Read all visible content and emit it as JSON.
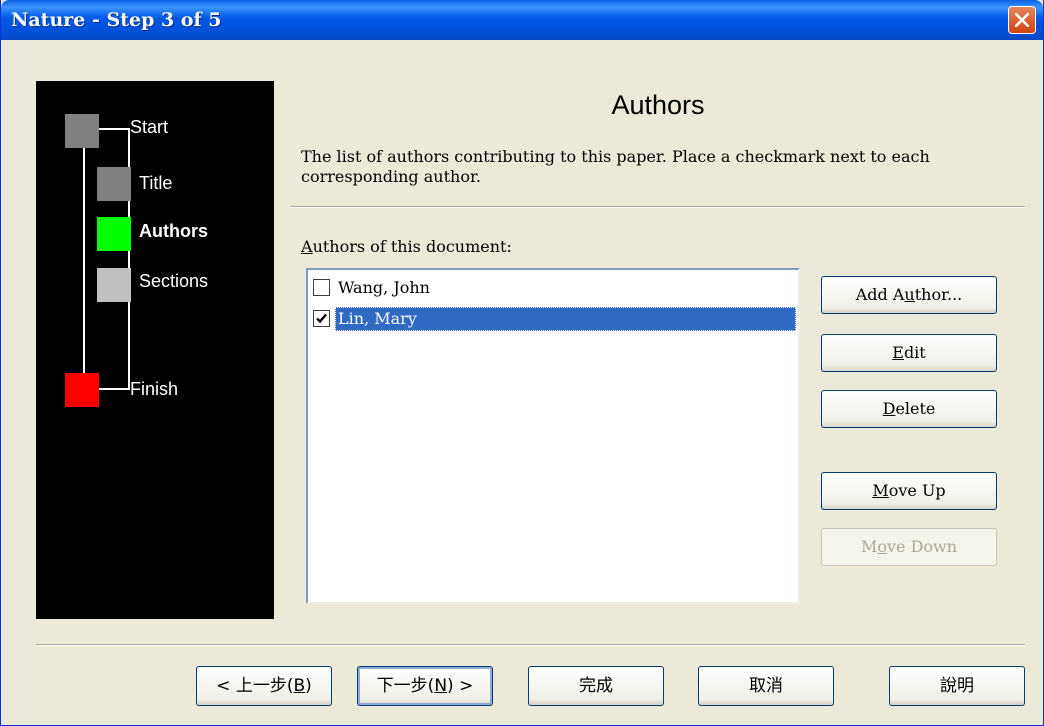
{
  "window": {
    "title": "Nature - Step 3 of 5"
  },
  "steps": [
    {
      "label": "Start",
      "color": "#808080",
      "current": false
    },
    {
      "label": "Title",
      "color": "#808080",
      "current": false
    },
    {
      "label": "Authors",
      "color": "#00FF00",
      "current": true
    },
    {
      "label": "Sections",
      "color": "#C0C0C0",
      "current": false
    },
    {
      "label": "Finish",
      "color": "#FF0000",
      "current": false
    }
  ],
  "page": {
    "heading": "Authors",
    "description": "The list of authors contributing to this paper. Place a checkmark next to each corresponding author."
  },
  "authors_list": {
    "label_accel": "A",
    "label_rest": "uthors of this document:",
    "items": [
      {
        "name": "Wang, John",
        "checked": false,
        "selected": false
      },
      {
        "name": "Lin, Mary",
        "checked": true,
        "selected": true
      }
    ]
  },
  "buttons": {
    "add_author": {
      "pre": "Add A",
      "accel": "u",
      "post": "thor...",
      "enabled": true
    },
    "edit": {
      "pre": "",
      "accel": "E",
      "post": "dit",
      "enabled": true
    },
    "delete": {
      "pre": "",
      "accel": "D",
      "post": "elete",
      "enabled": true
    },
    "move_up": {
      "pre": "",
      "accel": "M",
      "post": "ove Up",
      "enabled": true
    },
    "move_down": {
      "pre": "M",
      "accel": "o",
      "post": "ve Down",
      "enabled": false
    }
  },
  "footer": {
    "back": {
      "pre": "< 上一步(",
      "accel": "B",
      "post": ")"
    },
    "next": {
      "pre": "下一步(",
      "accel": "N",
      "post": ") >"
    },
    "finish": "完成",
    "cancel": "取消",
    "help": "說明"
  }
}
